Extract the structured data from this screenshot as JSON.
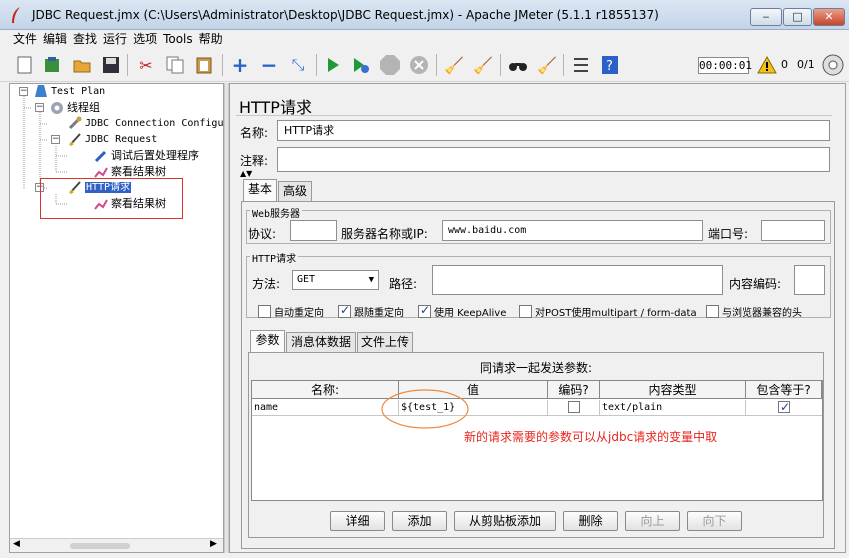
{
  "window": {
    "title": "JDBC Request.jmx (C:\\Users\\Administrator\\Desktop\\JDBC Request.jmx) - Apache JMeter (5.1.1 r1855137)",
    "min": "‒",
    "max": "□",
    "close": "✕"
  },
  "menu": [
    "文件",
    "编辑",
    "查找",
    "运行",
    "选项",
    "Tools",
    "帮助"
  ],
  "toolbar": {
    "timer": "00:00:01",
    "warn_count": "0",
    "threads": "0/1"
  },
  "tree": {
    "test_plan": "Test Plan",
    "thread_group": "线程组",
    "jdbc_connection": "JDBC Connection Configu",
    "jdbc_request": "JDBC Request",
    "debug_post": "调试后置处理程序",
    "view_results_1": "察看结果树",
    "http_request": "HTTP请求",
    "view_results_2": "察看结果树"
  },
  "panel": {
    "title": "HTTP请求",
    "name_label": "名称:",
    "name_value": "HTTP请求",
    "comment_label": "注释:",
    "tabs": [
      "基本",
      "高级"
    ],
    "web_server": {
      "legend": "Web服务器",
      "protocol_label": "协议:",
      "server_label": "服务器名称或IP:",
      "server_value": "www.baidu.com",
      "port_label": "端口号:"
    },
    "http": {
      "legend": "HTTP请求",
      "method_label": "方法:",
      "method_value": "GET",
      "path_label": "路径:",
      "encoding_label": "内容编码:",
      "checkboxes": {
        "redirect_auto": "自动重定向",
        "follow_redirects": "跟随重定向",
        "keepalive": "使用 KeepAlive",
        "multipart": "对POST使用multipart / form-data",
        "browser_headers": "与浏览器兼容的头"
      }
    },
    "subtabs": [
      "参数",
      "消息体数据",
      "文件上传"
    ],
    "params": {
      "caption": "同请求一起发送参数:",
      "headers": [
        "名称:",
        "值",
        "编码?",
        "内容类型",
        "包含等于?"
      ],
      "rows": [
        {
          "name": "name",
          "value": "${test_1}",
          "content_type": "text/plain"
        }
      ]
    },
    "annotation": "新的请求需要的参数可以从jdbc请求的变量中取",
    "buttons": [
      "详细",
      "添加",
      "从剪贴板添加",
      "删除",
      "向上",
      "向下"
    ]
  },
  "colors": {
    "annotation_red": "#e8241c",
    "highlight_box": "#d9342b",
    "ellipse_orange": "#f08a3c",
    "selection_blue": "#3161c4"
  }
}
